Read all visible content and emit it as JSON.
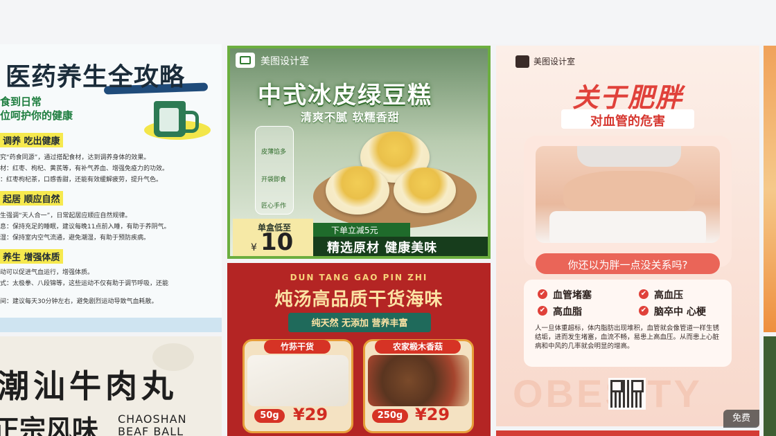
{
  "cards": {
    "health": {
      "title": "医药养生全攻略",
      "subtitle1": "食到日常",
      "subtitle2": "位呵护你的健康",
      "section1_head": "调养 吃出健康",
      "section1_lines": [
        "究“药食同源”，通过搭配食材，达到调养身体的效果。",
        "材：红枣、枸杞、黄芪等，有补气养血、增强免疫力的功效。",
        "：红枣枸杞茶，口感香甜，还能有效缓解疲劳，提升气色。"
      ],
      "section2_head": "起居 顺应自然",
      "section2_lines": [
        "生强调“天人合一”，日常起居应顺应自然规律。",
        "息：保持充足的睡眠，建议每晚11点前入睡，有助于养阴气。",
        "湿：保持室内空气流通，避免潮湿，有助于预防疾病。"
      ],
      "section3_head": "养生 增强体质",
      "section3_lines": [
        "动可以促进气血运行，增强体质。",
        "式：太极拳、八段锦等，这些运动不仅有助于调节呼吸，还能",
        "间：建议每天30分钟左右，避免剧烈运动导致气血耗散。"
      ]
    },
    "beef": {
      "title_line1": "潮汕牛肉丸",
      "title_line2": "正宗风味",
      "en1": "CHAOSHAN",
      "en2": "BEAF BALL"
    },
    "mooncake": {
      "brand": "美图设计室",
      "title": "中式冰皮绿豆糕",
      "subtitle": "清爽不腻 软糯香甜",
      "features": [
        "皮薄馅多",
        "开袋即食",
        "匠心手作"
      ],
      "price_label": "单盒低至",
      "price_symbol": "¥",
      "price": "10",
      "promo": "下单立减5元",
      "slogan": "精选原材 健康美味"
    },
    "stew": {
      "en": "DUN TANG GAO PIN ZHI",
      "title": "炖汤高品质干货海味",
      "ribbon": "纯天然 无添加 营养丰富",
      "products": [
        {
          "tag": "竹荪干货",
          "weight": "50g",
          "price": "¥29"
        },
        {
          "tag": "农家椴木香菇",
          "weight": "250g",
          "price": "¥29"
        }
      ]
    },
    "obesity": {
      "brand": "美图设计室",
      "title": "关于肥胖",
      "subtitle": "对血管的危害",
      "question": "你还以为胖一点没关系吗?",
      "risks": [
        "血管堵塞",
        "高血压",
        "高血脂",
        "脑卒中 心梗"
      ],
      "check_icon": "✔",
      "description": "人一旦体重超标，体内脂肪出现堆积，血管就会像管道一样生锈结垢，进而发生堵塞，血流不畅，易患上高血压。从而患上心脏病和中风的几率就会明显的增高。",
      "watermark": "OBESITY",
      "free_badge": "免费"
    }
  },
  "colors": {
    "mooncake_border": "#6cae3f",
    "stew_bg": "#b42524",
    "obesity_accent": "#e0413a"
  }
}
